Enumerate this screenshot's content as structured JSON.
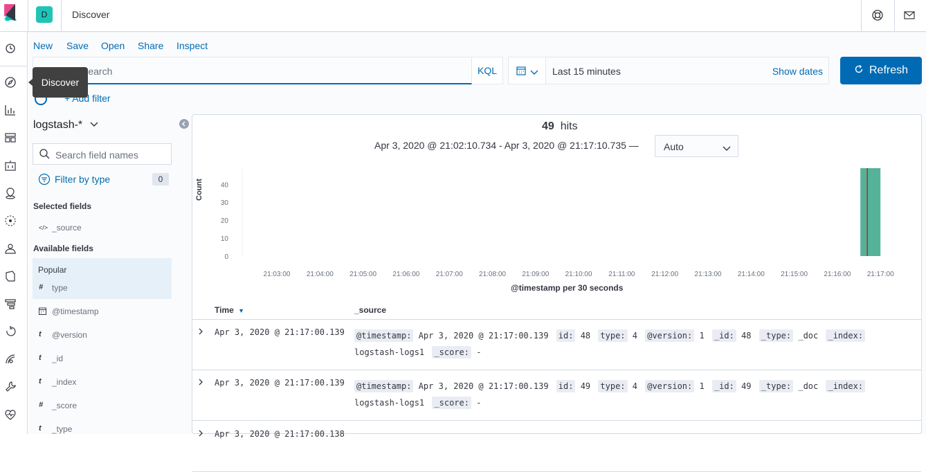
{
  "app": {
    "space_initial": "D",
    "breadcrumb": "Discover"
  },
  "tooltip": "Discover",
  "menu": [
    "New",
    "Save",
    "Open",
    "Share",
    "Inspect"
  ],
  "search": {
    "placeholder": "Search",
    "language": "KQL"
  },
  "datepicker": {
    "range": "Last 15 minutes",
    "show_dates": "Show dates"
  },
  "refresh_label": "Refresh",
  "add_filter": "+ Add filter",
  "index_pattern": "logstash-*",
  "field_search_placeholder": "Search field names",
  "filter_by_type": {
    "label": "Filter by type",
    "count": "0"
  },
  "sections": {
    "selected": "Selected fields",
    "available": "Available fields",
    "popular": "Popular"
  },
  "selected_fields": [
    {
      "type": "</>",
      "name": "_source"
    }
  ],
  "popular_fields": [
    {
      "type": "#",
      "name": "type"
    }
  ],
  "available_fields": [
    {
      "type": "cal",
      "name": "@timestamp"
    },
    {
      "type": "t",
      "name": "@version"
    },
    {
      "type": "t",
      "name": "_id"
    },
    {
      "type": "t",
      "name": "_index"
    },
    {
      "type": "#",
      "name": "_score"
    },
    {
      "type": "t",
      "name": "_type"
    }
  ],
  "hits": {
    "count": "49",
    "label": "hits"
  },
  "time_range": "Apr 3, 2020 @ 21:02:10.734 - Apr 3, 2020 @ 21:17:10.735 —",
  "interval": "Auto",
  "chart_data": {
    "type": "bar",
    "ylabel": "Count",
    "xlabel": "@timestamp per 30 seconds",
    "yticks": [
      0,
      10,
      20,
      30,
      40
    ],
    "ylim": [
      0,
      49
    ],
    "categories": [
      "21:03:00",
      "21:04:00",
      "21:05:00",
      "21:06:00",
      "21:07:00",
      "21:08:00",
      "21:09:00",
      "21:10:00",
      "21:11:00",
      "21:12:00",
      "21:13:00",
      "21:14:00",
      "21:15:00",
      "21:16:00",
      "21:17:00"
    ],
    "bars": [
      {
        "x": "21:17:00",
        "value": 49
      }
    ],
    "bar_color": "#54b399",
    "marker_color": "#bd271e"
  },
  "table": {
    "col_time": "Time",
    "col_source": "_source",
    "rows": [
      {
        "time": "Apr 3, 2020 @ 21:17:00.139",
        "fields": [
          [
            "@timestamp:",
            "Apr 3, 2020 @ 21:17:00.139"
          ],
          [
            "id:",
            "48"
          ],
          [
            "type:",
            "4"
          ],
          [
            "@version:",
            "1"
          ],
          [
            "_id:",
            "48"
          ],
          [
            "_type:",
            "_doc"
          ],
          [
            "_index:",
            "logstash-logs1"
          ],
          [
            "_score:",
            "-"
          ]
        ]
      },
      {
        "time": "Apr 3, 2020 @ 21:17:00.139",
        "fields": [
          [
            "@timestamp:",
            "Apr 3, 2020 @ 21:17:00.139"
          ],
          [
            "id:",
            "49"
          ],
          [
            "type:",
            "4"
          ],
          [
            "@version:",
            "1"
          ],
          [
            "_id:",
            "49"
          ],
          [
            "_type:",
            "_doc"
          ],
          [
            "_index:",
            "logstash-logs1"
          ],
          [
            "_score:",
            "-"
          ]
        ]
      },
      {
        "time": "Apr 3, 2020 @ 21:17:00.138",
        "fields": []
      }
    ]
  },
  "colors": {
    "accent": "#006bb4",
    "space": "#20c4b6"
  }
}
